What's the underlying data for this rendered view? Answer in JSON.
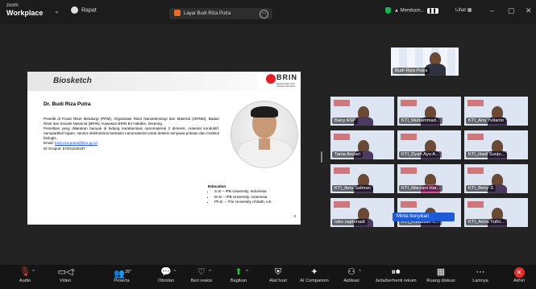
{
  "titlebar": {
    "brand_small": "zoom",
    "brand_big": "Workplace",
    "meeting_label": "Rapat",
    "share_label": "Layar Budi Riza Putra",
    "record_label": "Merekam...",
    "view_label": "Lihat"
  },
  "slide": {
    "title": "Biosketch",
    "logo_name": "BRIN",
    "logo_sub": "BADAN RISET DAN INOVASI NASIONAL",
    "presenter": "Dr. Budi Riza Putra",
    "para1": "Peneliti di Pusat Riset Metalurgi (PRM), Organisasi Riset Nanoteknologi dan Material (ORNM), Badan Riset dan Inovasi Nasional (BRIN), Kawasan BRIN BJ Habibie, Serpong.",
    "para2": "Penelitian yang dilakukan banyak di bidang karakterisasi nanomaterial 2 dimensi, material konduktif, nanopartikel logam, sensor elektrokimia berbasis nanomaterial untuk deteksi senyawa polutan dan molekul biologis.",
    "email_label": "Email:",
    "email": "budi.riza.putra@brin.go.id",
    "scopus": "ID Scopus: 57201226197",
    "edu_title": "Education",
    "edu": [
      "S.Si – IPB University, Indonesia",
      "M.Si – IPB University, Indonesia",
      "Ph.D. – The University of Bath, UK"
    ],
    "page": "2"
  },
  "speaker": {
    "name": "Budi Riza Putra"
  },
  "participants": [
    "Bany ASP",
    "KTI_Muhammad...",
    "KTI_Aris Yulianto",
    "Tania Andari",
    "KTI_Dyah Ayu A...",
    "KTI_Hadi Sunjo...",
    "KTI_Ibnu Salman",
    "KTI_Maryani Har...",
    "KTI_Beny S",
    "Ioko saptonadi",
    "KTI_Primasari C...",
    "KTI_Arina Yulhi..."
  ],
  "toast": "Minta bunyikan",
  "toolbar": {
    "audio": "Audio",
    "video": "Video",
    "participants": "Peserta",
    "participants_count": "25",
    "chat": "Obrolan",
    "react": "Beri reaksi",
    "share": "Bagikan",
    "host_tools": "Alat host",
    "companion": "AI Companion",
    "apps": "Aplikasi",
    "record": "Jeda/berhenti rekam",
    "rooms": "Ruang diskusi",
    "more": "Lainnya",
    "end": "Akhiri"
  }
}
